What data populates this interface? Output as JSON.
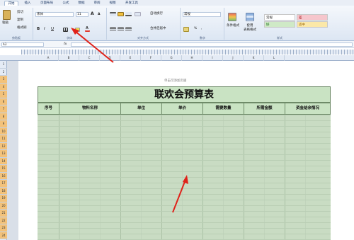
{
  "tabs": [
    "开始",
    "插入",
    "页面布局",
    "公式",
    "数据",
    "审阅",
    "视图",
    "开发工具"
  ],
  "active_tab": "开始",
  "clipboard": {
    "paste": "粘贴",
    "cut": "剪切",
    "copy": "复制",
    "format_painter": "格式刷",
    "label": "剪贴板"
  },
  "font": {
    "name": "宋体",
    "size": "11",
    "label": "字体",
    "bold": "B",
    "italic": "I",
    "underline": "U",
    "grow": "A",
    "shrink": "A"
  },
  "alignment": {
    "wrap": "自动换行",
    "merge": "合并后居中",
    "label": "对齐方式"
  },
  "number": {
    "format": "常规",
    "label": "数字",
    "pct": "%",
    "comma": ","
  },
  "styles": {
    "conditional": "条件格式",
    "table_format": "套用\n表格格式",
    "label": "样式",
    "cells": [
      {
        "text": "常规",
        "bg": "#ffffff"
      },
      {
        "text": "差",
        "bg": "#f6c6cc"
      },
      {
        "text": "好",
        "bg": "#cfe9c6"
      },
      {
        "text": "适中",
        "bg": "#fbe8a8"
      }
    ]
  },
  "formula_bar": {
    "cell_ref": "A3",
    "fx": "fx",
    "value": ""
  },
  "columns": [
    "A",
    "B",
    "C",
    "D",
    "E",
    "F",
    "G",
    "H",
    "I",
    "J",
    "K",
    "L"
  ],
  "rows": [
    "1",
    "2",
    "3",
    "4",
    "5",
    "6",
    "7",
    "8",
    "9",
    "10",
    "11",
    "12",
    "13",
    "14",
    "15",
    "16",
    "17",
    "18",
    "19",
    "20",
    "21",
    "22",
    "23",
    "24"
  ],
  "header_hint": "单击可添加页眉",
  "sheet": {
    "title": "联欢会预算表",
    "headers": [
      "序号",
      "物料名称",
      "单位",
      "单价",
      "需要数量",
      "所需金额",
      "资金结余情况"
    ]
  }
}
